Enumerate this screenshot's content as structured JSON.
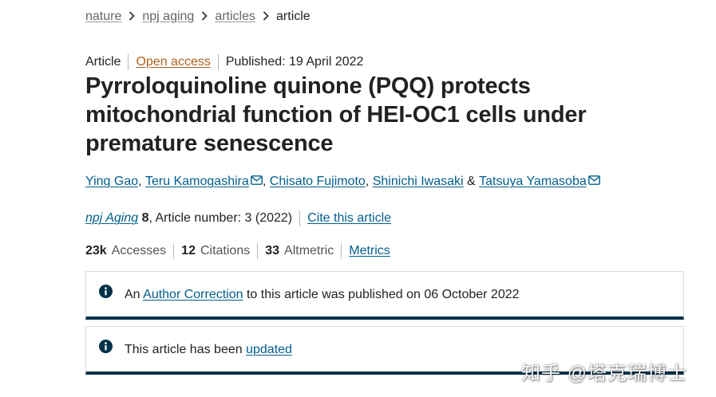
{
  "breadcrumb": {
    "items": [
      "nature",
      "npj aging",
      "articles"
    ],
    "current": "article"
  },
  "meta": {
    "type": "Article",
    "access": "Open access",
    "published": "Published: 19 April 2022"
  },
  "title": "Pyrroloquinoline quinone (PQQ) protects mitochondrial function of HEI-OC1 cells under premature senescence",
  "authors": {
    "a1": "Ying Gao",
    "sep1": ",",
    "a2": "Teru Kamogashira",
    "sep2": ",",
    "a3": "Chisato Fujimoto",
    "sep3": ",",
    "a4": "Shinichi Iwasaki",
    "amp": "&",
    "a5": "Tatsuya Yamasoba"
  },
  "journal": {
    "name": "npj Aging",
    "volume": "8",
    "article_number": ", Article number: 3 (2022)",
    "cite_label": "Cite this article"
  },
  "metrics": {
    "accesses_value": "23k",
    "accesses_label": "Accesses",
    "citations_value": "12",
    "citations_label": "Citations",
    "altmetric_value": "33",
    "altmetric_label": "Altmetric",
    "metrics_link": "Metrics"
  },
  "notices": {
    "correction_prefix": "An",
    "correction_link": "Author Correction",
    "correction_suffix": "to this article was published on 06 October 2022",
    "updated_prefix": "This article has been",
    "updated_link": "updated"
  },
  "icons": {
    "mail": "envelope-icon",
    "info": "info-circle-icon",
    "chevron": "chevron-right-icon"
  },
  "colors": {
    "link": "#025e8d",
    "open_access": "#b0601e",
    "notice_border": "#01324b"
  },
  "watermark": "知乎 @塔克瑞博士"
}
